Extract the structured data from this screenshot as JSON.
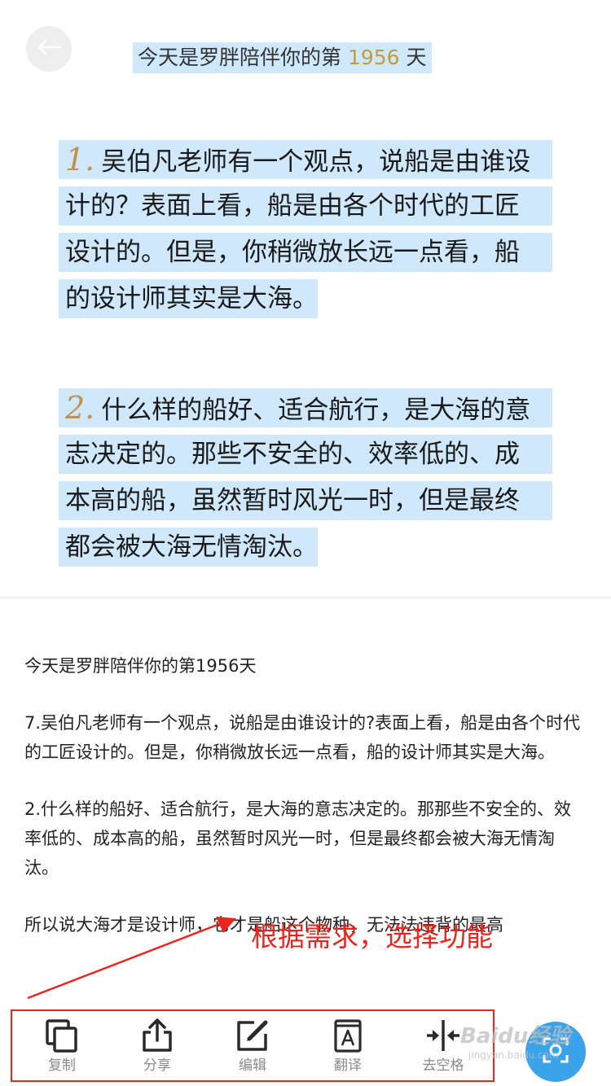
{
  "top_image": {
    "title_prefix": "今天是罗胖陪伴你的第 ",
    "title_number": "1956",
    "title_suffix": " 天",
    "para1": {
      "marker": "1.",
      "lines": [
        "吴伯凡老师有一个观点，说船是由谁设",
        "计的？表面上看，船是由各个时代的工匠",
        "设计的。但是，你稍微放长远一点看，船",
        "的设计师其实是大海。"
      ]
    },
    "para2": {
      "marker": "2.",
      "lines": [
        "什么样的船好、适合航行，是大海的意",
        "志决定的。那些不安全的、效率低的、成",
        "本高的船，虽然暂时风光一时，但是最终",
        "都会被大海无情淘汰。"
      ]
    }
  },
  "ocr_text": {
    "p1": "今天是罗胖陪伴你的第1956天",
    "p2": "7.吴伯凡老师有一个观点，说船是由谁设计的?表面上看，船是由各个时代的工匠设计的。但是，你稍微放长远一点看，船的设计师其实是大海。",
    "p3": "2.什么样的船好、适合航行，是大海的意志决定的。那那些不安全的、效率低的、成本高的船，虽然暂时风光一时，但是最终都会被大海无情淘汰。",
    "p4": "所以说大海才是设计师，它才是船这个物种，无法法违背的最高"
  },
  "annotation": {
    "text": "根据需求，选择功能",
    "color": "#e8261f"
  },
  "toolbar": {
    "copy": "复制",
    "share": "分享",
    "edit": "编辑",
    "translate": "翻译",
    "remove_spaces": "去空格"
  },
  "watermark": {
    "main": "Baidu经验",
    "sub": "jingyan.baidu.com"
  },
  "colors": {
    "highlight": "#cfe8fb",
    "marker": "#c2914a",
    "fab": "#3aa3ea",
    "label": "#8a8a8a"
  }
}
